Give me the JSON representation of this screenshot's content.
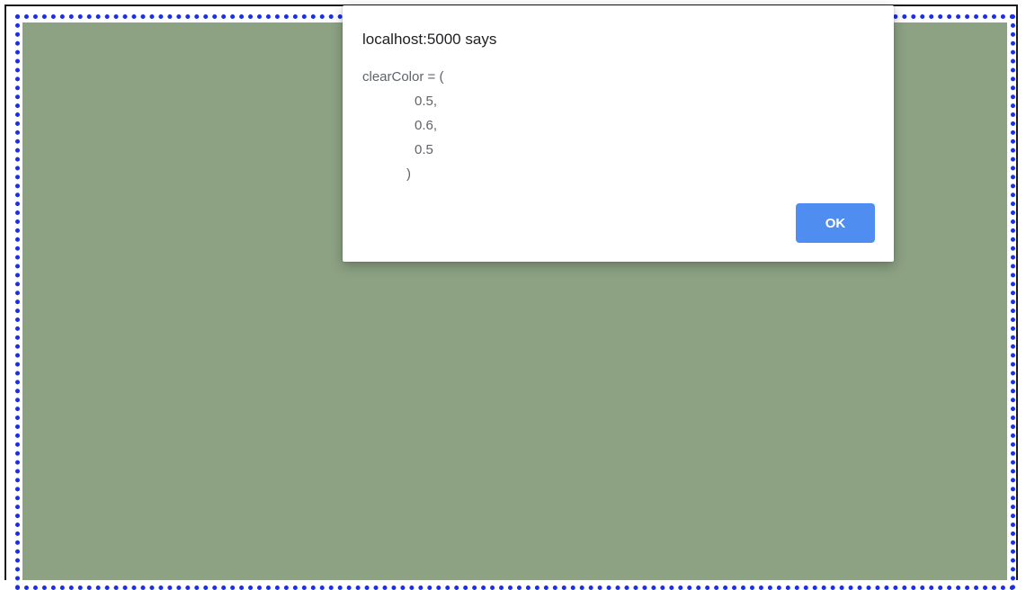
{
  "alert": {
    "origin_title": "localhost:5000 says",
    "message_lines": [
      "clearColor = (",
      "0.5,",
      "0.6,",
      "0.5",
      ")"
    ],
    "ok_label": "OK"
  },
  "colors": {
    "canvas_clear_color": "#8ca283",
    "canvas_outline": "#1a2fe6",
    "ok_button": "#4f8df0"
  }
}
